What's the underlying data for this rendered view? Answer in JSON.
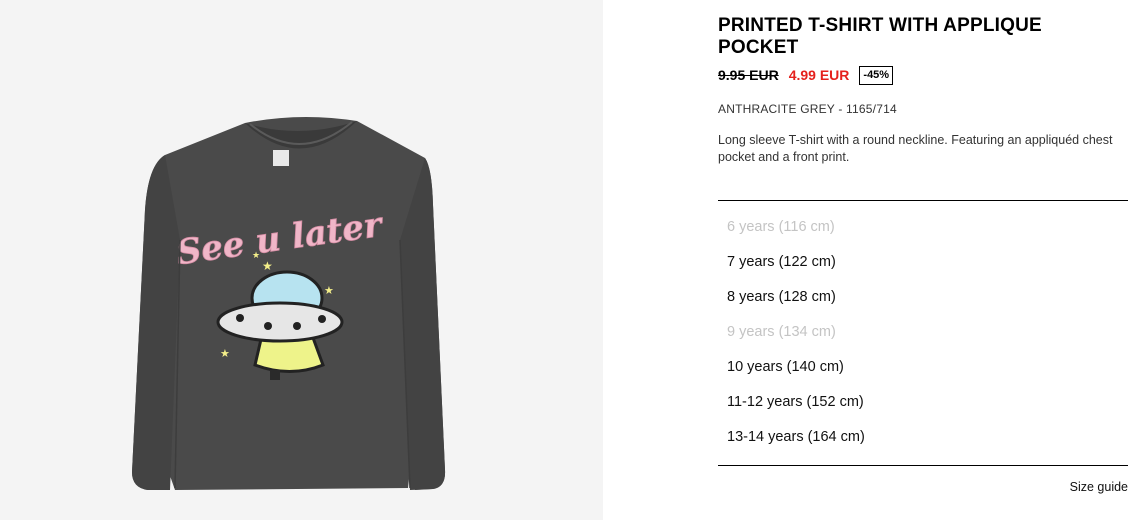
{
  "product": {
    "title": "PRINTED T-SHIRT WITH APPLIQUE POCKET",
    "price_old": "9.95 EUR",
    "price_new": "4.99 EUR",
    "discount": "-45%",
    "color_ref": "ANTHRACITE GREY - 1165/714",
    "description": "Long sleeve T-shirt with a round neckline. Featuring an appliquéd chest pocket and a front print."
  },
  "image": {
    "print_text": "See u later",
    "shirt_color": "#4a4a4a",
    "background_color": "#f4f4f4"
  },
  "sizes": [
    {
      "label": "6 years (116 cm)",
      "available": false
    },
    {
      "label": "7 years (122 cm)",
      "available": true
    },
    {
      "label": "8 years (128 cm)",
      "available": true
    },
    {
      "label": "9 years (134 cm)",
      "available": false
    },
    {
      "label": "10 years (140 cm)",
      "available": true
    },
    {
      "label": "11-12 years (152 cm)",
      "available": true
    },
    {
      "label": "13-14 years (164 cm)",
      "available": true
    }
  ],
  "size_guide_label": "Size guide",
  "colors": {
    "sale_red": "#e5211d",
    "unavailable_grey": "#c4c4c4"
  }
}
